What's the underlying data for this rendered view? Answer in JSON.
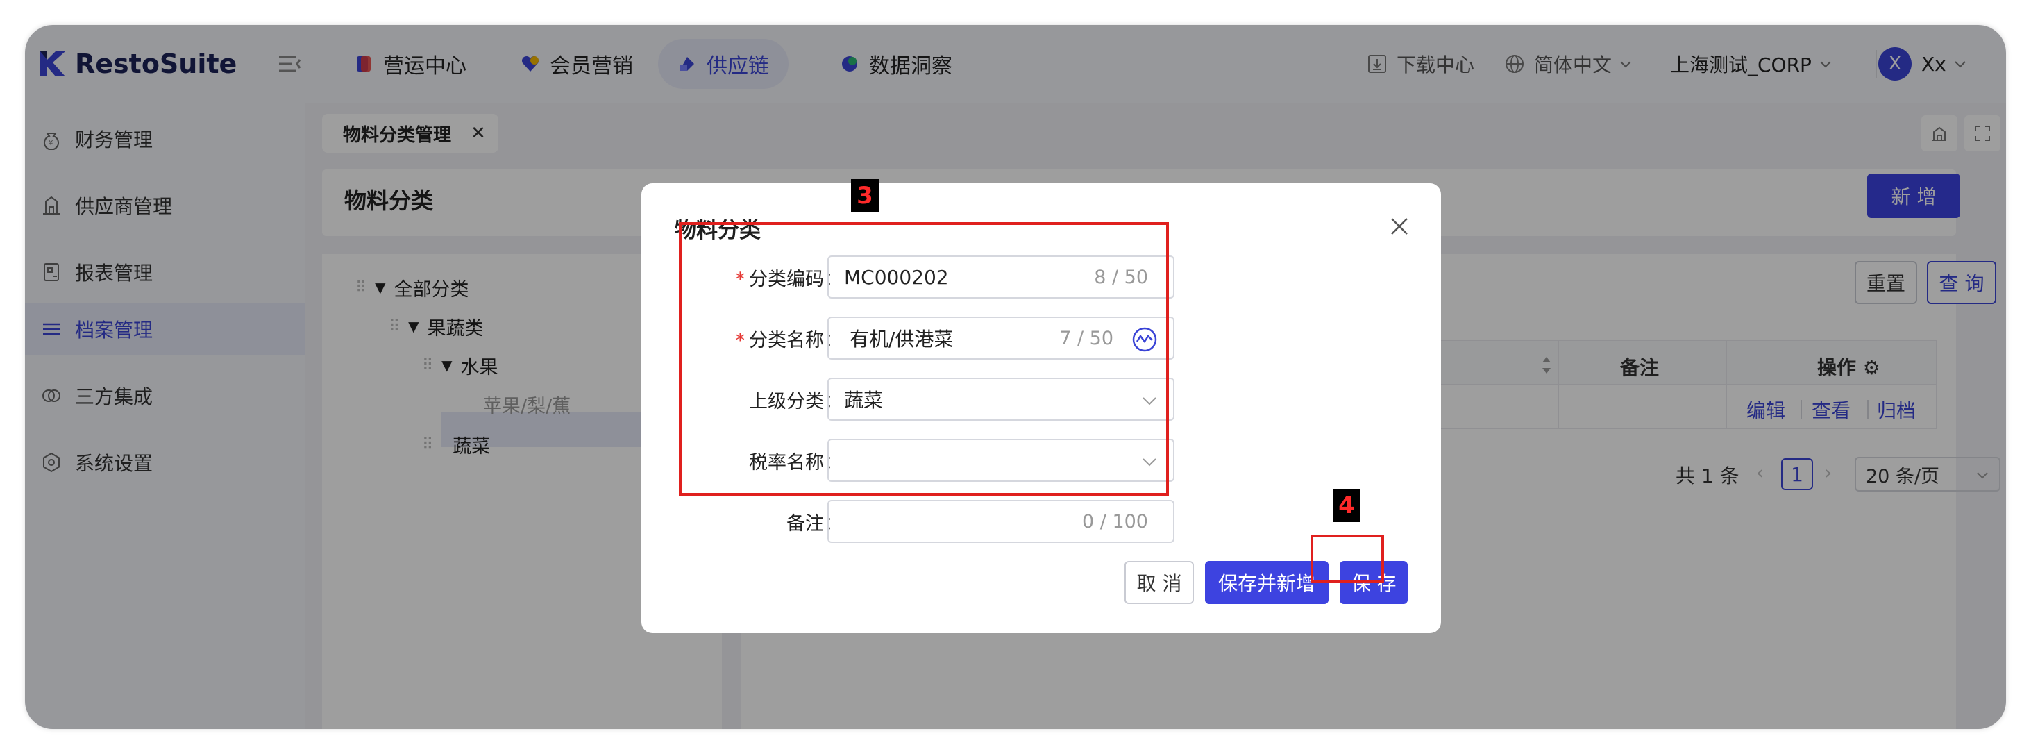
{
  "header": {
    "brand": "RestoSuite",
    "nav": [
      {
        "label": "营运中心",
        "active": false
      },
      {
        "label": "会员营销",
        "active": false
      },
      {
        "label": "供应链",
        "active": true
      },
      {
        "label": "数据洞察",
        "active": false
      }
    ],
    "download": "下载中心",
    "language": "简体中文",
    "org": "上海测试_CORP",
    "avatar_initial": "X",
    "user": "Xx"
  },
  "sidebar": {
    "items": [
      {
        "label": "财务管理",
        "icon": "money-bag-icon"
      },
      {
        "label": "供应商管理",
        "icon": "building-icon"
      },
      {
        "label": "报表管理",
        "icon": "report-icon"
      },
      {
        "label": "档案管理",
        "icon": "list-icon",
        "active": true
      },
      {
        "label": "三方集成",
        "icon": "integration-icon"
      },
      {
        "label": "系统设置",
        "icon": "settings-icon"
      }
    ]
  },
  "tabs": [
    {
      "label": "物料分类管理"
    }
  ],
  "page": {
    "title": "物料分类",
    "add_button": "新 增",
    "reset_button": "重置",
    "query_button": "查 询"
  },
  "tree": {
    "nodes": [
      {
        "label": "全部分类"
      },
      {
        "label": "果蔬类"
      },
      {
        "label": "水果"
      },
      {
        "label": "苹果/梨/蕉"
      },
      {
        "label": "蔬菜"
      }
    ]
  },
  "table": {
    "columns": [
      "备注",
      "操作"
    ],
    "actions": [
      "编辑",
      "查看",
      "归档"
    ]
  },
  "pagination": {
    "total": "共 1 条",
    "current": "1",
    "page_size": "20 条/页"
  },
  "dialog": {
    "title": "物料分类",
    "fields": {
      "code": {
        "label": "分类编码",
        "value": "MC000202",
        "count": "8 / 50",
        "required": true
      },
      "name": {
        "label": "分类名称",
        "value": "有机/供港菜",
        "count": "7 / 50",
        "required": true
      },
      "parent": {
        "label": "上级分类",
        "value": "蔬菜"
      },
      "tax": {
        "label": "税率名称",
        "value": ""
      },
      "remark": {
        "label": "备注",
        "value": "",
        "count": "0 / 100"
      }
    },
    "cancel": "取 消",
    "save_new": "保存并新增",
    "save": "保 存"
  },
  "annotations": [
    {
      "label": "3"
    },
    {
      "label": "4"
    }
  ],
  "colors": {
    "accent": "#3d43e0",
    "annotation": "#e0201e"
  }
}
